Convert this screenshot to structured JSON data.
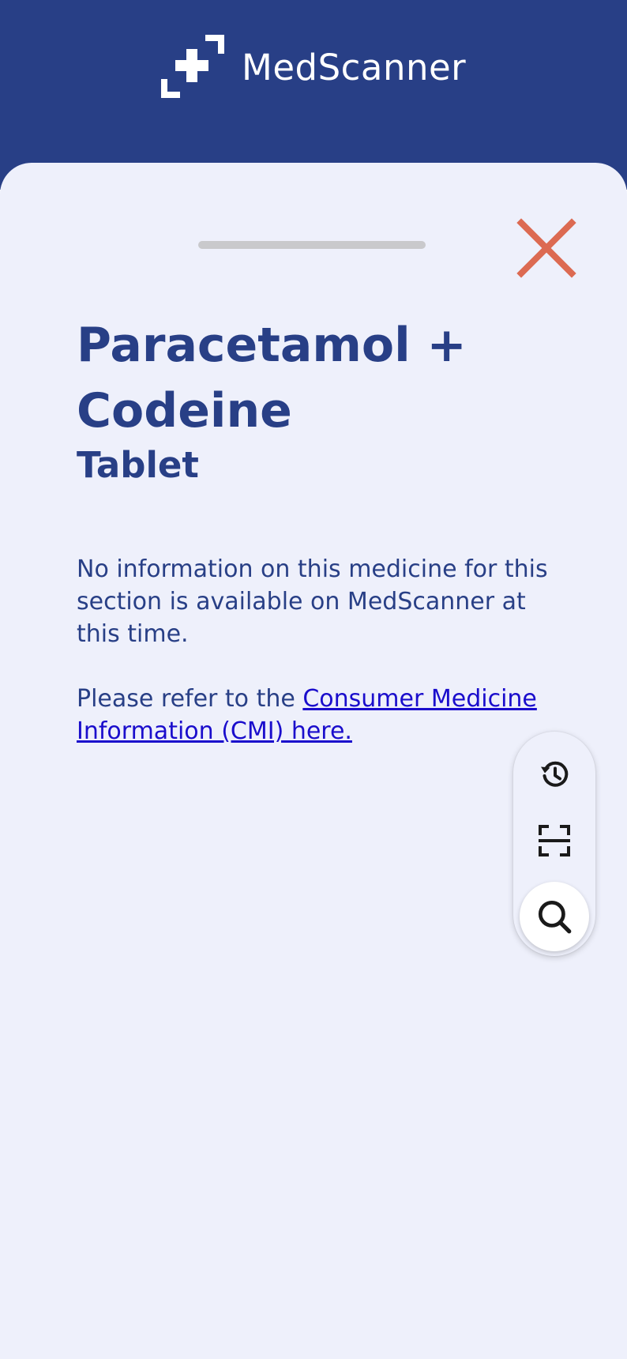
{
  "app": {
    "name": "MedScanner",
    "logo_icon": "medscanner-cross-logo-icon"
  },
  "colors": {
    "header_bg": "#283f86",
    "sheet_bg": "#eef0fb",
    "text_primary": "#283f86",
    "close_accent": "#dc6a52",
    "link": "#1a0dcc"
  },
  "sheet": {
    "close_icon": "close-icon",
    "medicine_name": "Paracetamol + Codeine",
    "medicine_form": "Tablet",
    "notice": "No information on this medicine for this section is available on MedScanner at this time.",
    "refer_prefix": "Please refer to the ",
    "refer_link": "Consumer Medicine Information (CMI) here."
  },
  "fab": {
    "history_icon": "history-icon",
    "scan_icon": "scan-icon",
    "search_icon": "search-icon"
  }
}
